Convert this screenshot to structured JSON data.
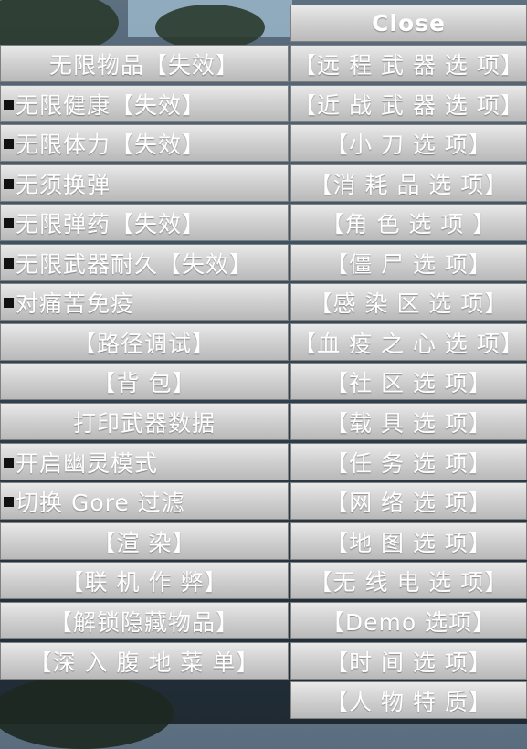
{
  "left_menu": [
    {
      "label": "无限物品【失效】",
      "bullet": false,
      "align": "center"
    },
    {
      "label": "无限健康【失效】",
      "bullet": true,
      "align": "left"
    },
    {
      "label": "无限体力【失效】",
      "bullet": true,
      "align": "left"
    },
    {
      "label": "无须换弹",
      "bullet": true,
      "align": "left"
    },
    {
      "label": "无限弹药【失效】",
      "bullet": true,
      "align": "left"
    },
    {
      "label": "无限武器耐久【失效】",
      "bullet": true,
      "align": "left"
    },
    {
      "label": "对痛苦免疫",
      "bullet": true,
      "align": "left"
    },
    {
      "label": "【路径调试】",
      "bullet": false,
      "align": "center"
    },
    {
      "label": "【背 包】",
      "bullet": false,
      "align": "center"
    },
    {
      "label": "打印武器数据",
      "bullet": false,
      "align": "center"
    },
    {
      "label": "开启幽灵模式",
      "bullet": true,
      "align": "left"
    },
    {
      "label": "切换 Gore 过滤",
      "bullet": true,
      "align": "left"
    },
    {
      "label": "【渲 染】",
      "bullet": false,
      "align": "center"
    },
    {
      "label": "【联 机 作 弊】",
      "bullet": false,
      "align": "center"
    },
    {
      "label": "【解锁隐藏物品】",
      "bullet": false,
      "align": "center"
    },
    {
      "label": "【深 入 腹 地 菜 单】",
      "bullet": false,
      "align": "center"
    }
  ],
  "right_menu": [
    {
      "label": "Close"
    },
    {
      "label": "【远 程 武 器 选 项】"
    },
    {
      "label": "【近 战 武 器 选 项】"
    },
    {
      "label": "【小 刀 选 项】"
    },
    {
      "label": "【消 耗 品 选 项】"
    },
    {
      "label": "【角 色 选 项 】"
    },
    {
      "label": "【僵 尸 选 项】"
    },
    {
      "label": "【感 染 区 选 项】"
    },
    {
      "label": "【血 疫 之 心 选 项】"
    },
    {
      "label": "【社 区 选 项】"
    },
    {
      "label": "【载 具 选 项】"
    },
    {
      "label": "【任 务 选 项】"
    },
    {
      "label": "【网 络 选 项】"
    },
    {
      "label": "【地 图 选 项】"
    },
    {
      "label": "【无 线 电 选 项】"
    },
    {
      "label": "【Demo 选项】"
    },
    {
      "label": "【时 间 选 项】"
    },
    {
      "label": "【人 物 特 质】"
    }
  ]
}
